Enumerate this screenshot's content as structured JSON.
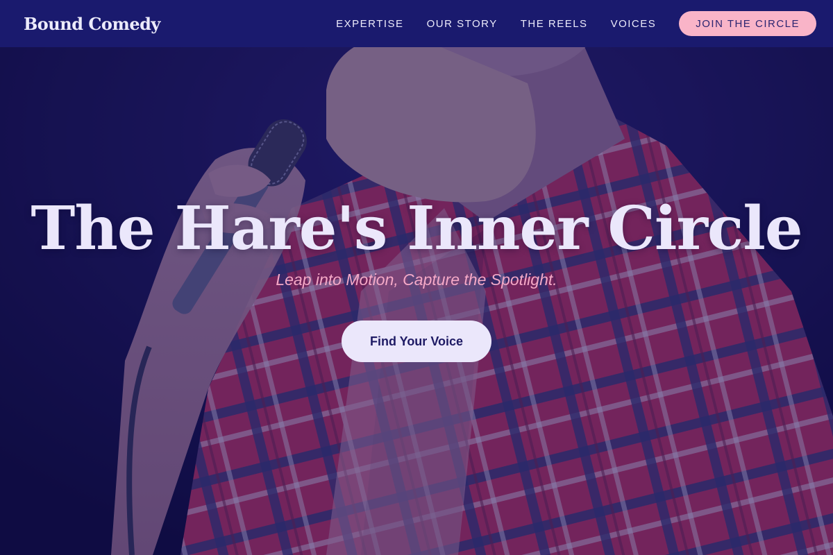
{
  "nav": {
    "brand": "Bound Comedy",
    "links": [
      {
        "label": "EXPERTISE"
      },
      {
        "label": "OUR STORY"
      },
      {
        "label": "THE REELS"
      },
      {
        "label": "VOICES"
      }
    ],
    "cta_label": "JOIN THE CIRCLE"
  },
  "hero": {
    "title": "The Hare's Inner Circle",
    "tagline": "Leap into Motion, Capture the Spotlight.",
    "button_label": "Find Your Voice",
    "background_image": "comedian-with-microphone-photo"
  },
  "colors": {
    "nav_background": "#1a1a6e",
    "cta_background": "#f9b4c8",
    "tagline": "#f5a9c7",
    "title": "#ebe7fb",
    "button_background": "#ebe7fb",
    "button_text": "#1e1a64"
  }
}
